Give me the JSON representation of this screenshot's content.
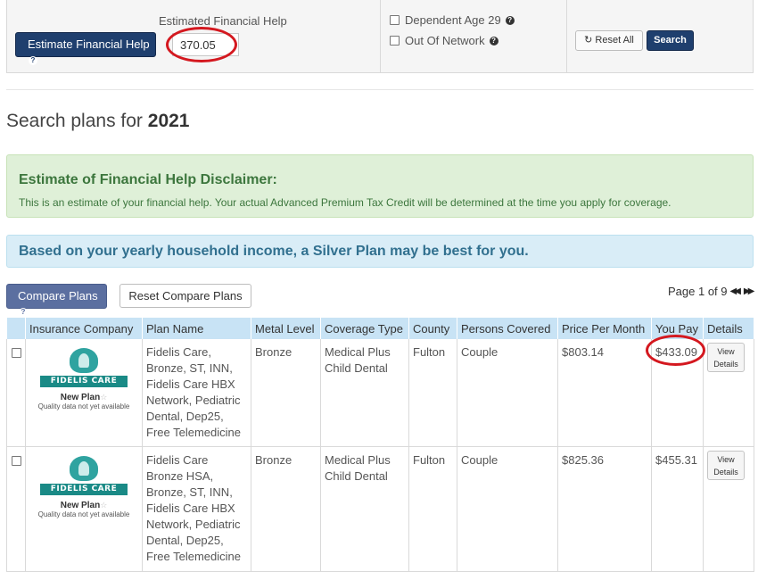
{
  "filters": {
    "estimate_button_label": "Estimate Financial Help",
    "estimate_label": "Estimated Financial Help",
    "estimate_value": "370.05",
    "dependent_label": "Dependent Age 29",
    "network_label": "Out Of Network",
    "reset_all_label": "Reset All",
    "search_label": "Search",
    "help_glyph": "?"
  },
  "page": {
    "title_prefix": "Search plans for",
    "title_year": "2021"
  },
  "disclaimer": {
    "heading": "Estimate of Financial Help Disclaimer:",
    "text": "This is an estimate of your financial help. Your actual Advanced Premium Tax Credit will be determined at the time you apply for coverage."
  },
  "recommendation": "Based on your yearly household income, a Silver Plan may be best for you.",
  "compare": {
    "compare_label": "Compare Plans",
    "reset_label": "Reset Compare Plans",
    "page_info": "Page 1 of 9"
  },
  "table": {
    "headers": [
      "Insurance Company",
      "Plan Name",
      "Metal Level",
      "Coverage Type",
      "County",
      "Persons Covered",
      "Price Per Month",
      "You Pay",
      "Details"
    ],
    "logo_text": "FIDELIS CARE",
    "new_plan_label": "New Plan",
    "quality_note": "Quality data not yet available",
    "view_label_1": "View",
    "view_label_2": "Details",
    "rows": [
      {
        "plan_name": "Fidelis Care, Bronze, ST, INN, Fidelis Care HBX Network, Pediatric Dental, Dep25, Free Telemedicine",
        "metal_level": "Bronze",
        "coverage_type": "Medical Plus Child Dental",
        "county": "Fulton",
        "persons_covered": "Couple",
        "price_per_month": "$803.14",
        "you_pay": "$433.09"
      },
      {
        "plan_name": "Fidelis Care Bronze HSA, Bronze, ST, INN, Fidelis Care HBX Network, Pediatric Dental, Dep25, Free Telemedicine",
        "metal_level": "Bronze",
        "coverage_type": "Medical Plus Child Dental",
        "county": "Fulton",
        "persons_covered": "Couple",
        "price_per_month": "$825.36",
        "you_pay": "$455.31"
      }
    ]
  },
  "colors": {
    "primary": "#1f3f6e",
    "highlight_oval": "#d4181f",
    "success_bg": "#dff0d8",
    "info_bg": "#d9edf7",
    "table_header_bg": "#c8e3f5"
  }
}
